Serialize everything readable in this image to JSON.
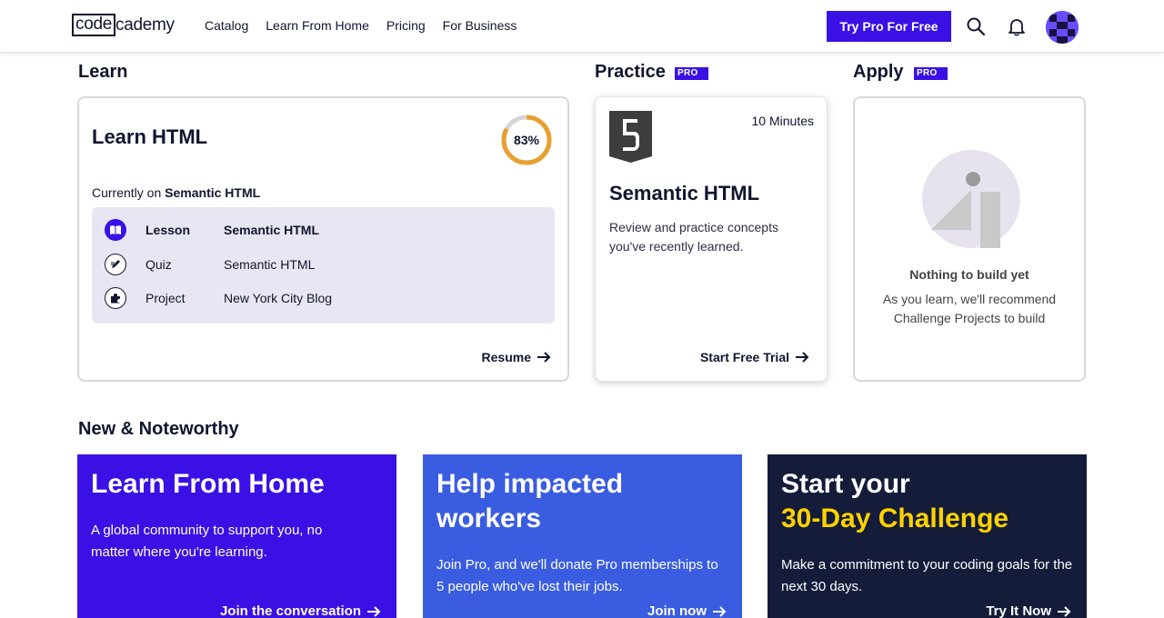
{
  "header": {
    "logo_code": "code",
    "logo_rest": "cademy",
    "nav": [
      "Catalog",
      "Learn From Home",
      "Pricing",
      "For Business"
    ],
    "cta": "Try Pro For Free",
    "icons": [
      "search-icon",
      "bell-icon",
      "avatar"
    ]
  },
  "learn": {
    "section_title": "Learn",
    "course_title": "Learn HTML",
    "progress_percent": 83,
    "progress_label": "83%",
    "currently_prefix": "Currently on",
    "currently_topic": "Semantic HTML",
    "modules": [
      {
        "type": "Lesson",
        "name": "Semantic HTML",
        "icon": "book-icon",
        "active": true
      },
      {
        "type": "Quiz",
        "name": "Semantic HTML",
        "icon": "pencil-icon",
        "active": false
      },
      {
        "type": "Project",
        "name": "New York City Blog",
        "icon": "puzzle-icon",
        "active": false
      }
    ],
    "action": "Resume"
  },
  "practice": {
    "section_title": "Practice",
    "badge": "PRO",
    "duration": "10 Minutes",
    "title": "Semantic HTML",
    "description": "Review and practice concepts you've recently learned.",
    "action": "Start Free Trial"
  },
  "apply": {
    "section_title": "Apply",
    "badge": "PRO",
    "empty_title": "Nothing to build yet",
    "empty_desc": "As you learn, we'll recommend Challenge Projects to build"
  },
  "noteworthy": {
    "section_title": "New & Noteworthy",
    "tiles": [
      {
        "title": "Learn From Home",
        "desc": "A global community to support you, no matter where you're learning.",
        "link": "Join the conversation",
        "color": "#3a10e5"
      },
      {
        "title": "Help impacted workers",
        "desc": "Join Pro, and we'll donate Pro memberships to 5 people who've lost their jobs.",
        "link": "Join now",
        "color": "#3a5ce0"
      },
      {
        "title_line1": "Start your",
        "title_line2": "30-Day Challenge",
        "desc": "Make a commitment to your coding goals for the next 30 days.",
        "link": "Try It Now",
        "color": "#141c3a"
      }
    ]
  },
  "colors": {
    "brand": "#3a10e5",
    "progress": "#e8a030",
    "navy": "#10162f"
  }
}
